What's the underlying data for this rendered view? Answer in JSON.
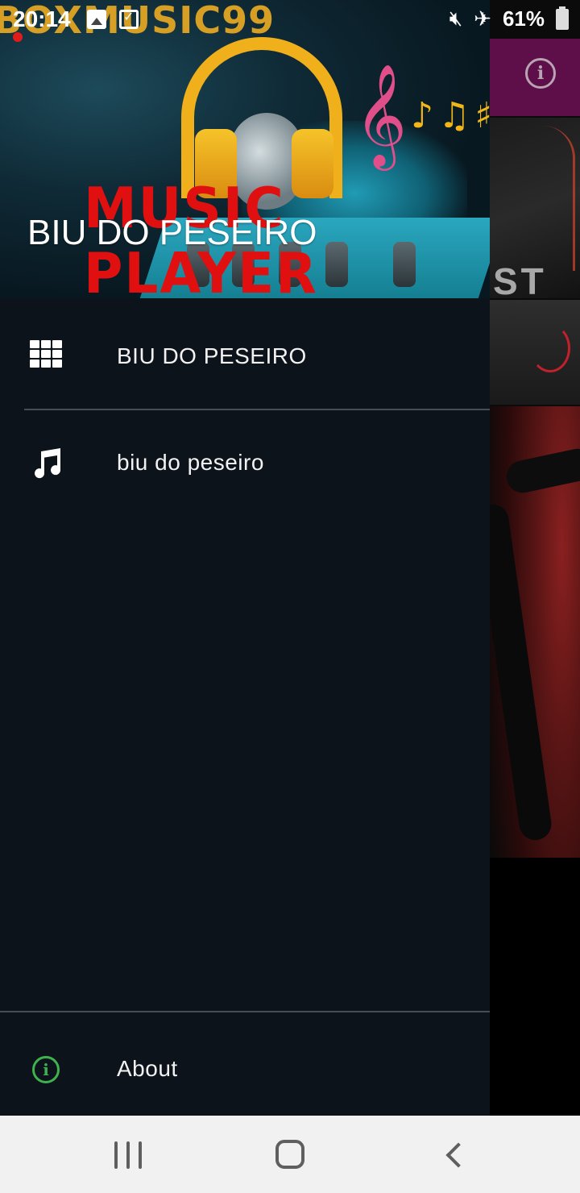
{
  "status_bar": {
    "time": "20:14",
    "battery": "61%",
    "icons": [
      "image-notification-icon",
      "download-notification-icon",
      "mute-icon",
      "airplane-mode-icon",
      "battery-icon"
    ]
  },
  "drawer": {
    "header": {
      "title": "BIU DO PESEIRO",
      "brand_text": "BOXMUSIC99",
      "artwork_text": "MUSIC PLAYER"
    },
    "items": [
      {
        "label": "BIU DO PESEIRO",
        "icon": "grid-icon"
      },
      {
        "label": "biu do peseiro",
        "icon": "music-note-icon"
      }
    ],
    "footer_item": {
      "label": "About",
      "icon": "info-icon"
    }
  },
  "background_app": {
    "partial_text": "ST",
    "toolbar_icon": "info-icon"
  },
  "colors": {
    "drawer_bg": "#0d131b",
    "toolbar": "#5e0f4a",
    "about_icon": "#3fb14f",
    "divider": "#474d55",
    "nav_bar": "#f1f1f1"
  },
  "nav_bar": {
    "buttons": [
      "recent-apps-button",
      "home-button",
      "back-button"
    ]
  }
}
